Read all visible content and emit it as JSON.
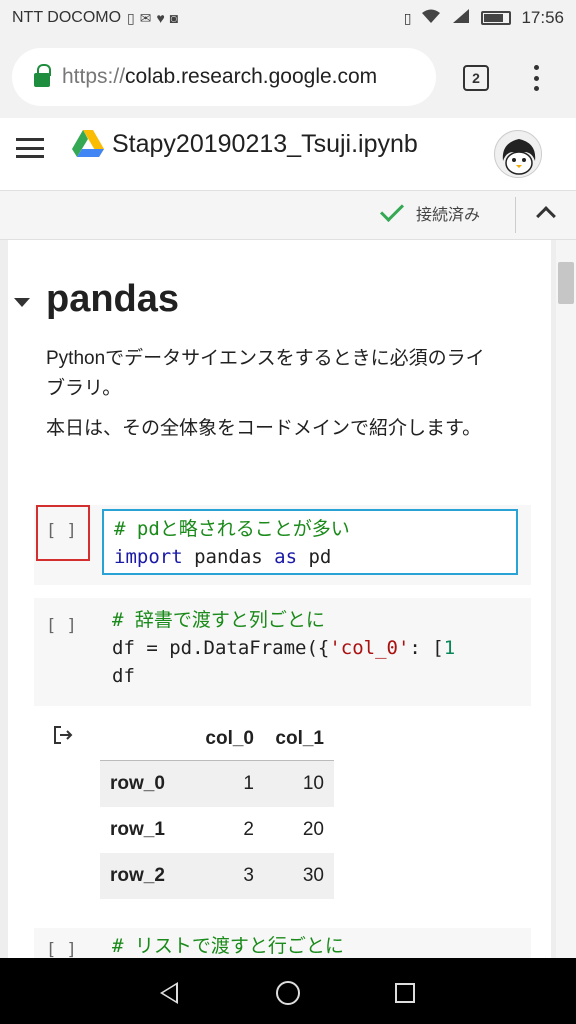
{
  "status_bar": {
    "carrier": "NTT DOCOMO",
    "time": "17:56",
    "icons": [
      "sim-icon",
      "mail-icon",
      "heart-icon",
      "instagram-icon",
      "vibrate-icon",
      "wifi-icon",
      "signal-icon",
      "battery-icon"
    ]
  },
  "browser": {
    "url_scheme": "https://",
    "url_host": "colab.research.google.com",
    "tab_count": "2"
  },
  "notebook": {
    "title": "Stapy20190213_Tsuji.ipynb",
    "status": "接続済み"
  },
  "section": {
    "title": "pandas",
    "paragraph1": "Pythonでデータサイエンスをするときに必須のライブラリ。",
    "paragraph2": "本日は、その全体象をコードメインで紹介します。"
  },
  "cells": [
    {
      "run_label": "[ ]",
      "comment": "# pdと略されることが多い",
      "line2_kw1": "import",
      "line2_mod": " pandas ",
      "line2_kw2": "as",
      "line2_alias": " pd"
    },
    {
      "run_label": "[ ]",
      "comment": "# 辞書で渡すと列ごとに",
      "line2_a": "df = pd.DataFrame({",
      "line2_str": "'col_0'",
      "line2_b": ": [",
      "line2_num": "1",
      "line3": "df"
    },
    {
      "run_label": "[ ]",
      "comment": "# リストで渡すと行ごとに"
    }
  ],
  "dataframe": {
    "columns": [
      "",
      "col_0",
      "col_1"
    ],
    "rows": [
      [
        "row_0",
        "1",
        "10"
      ],
      [
        "row_1",
        "2",
        "20"
      ],
      [
        "row_2",
        "3",
        "30"
      ]
    ]
  },
  "colors": {
    "check": "#34a853",
    "run_highlight": "#d32f2f",
    "editor_border": "#29a3d6",
    "comment": "#1a8a1a",
    "keyword": "#1a1aa6"
  }
}
